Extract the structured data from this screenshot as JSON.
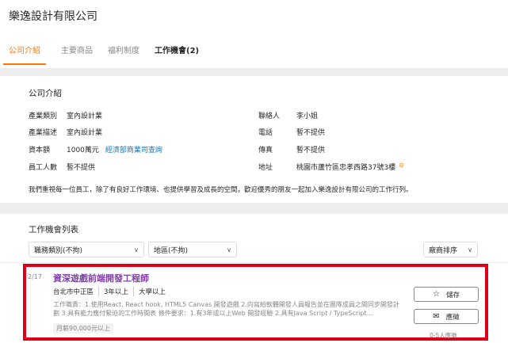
{
  "company": {
    "name": "樂逸設計有限公司"
  },
  "tabs": [
    {
      "label": "公司介紹"
    },
    {
      "label": "主要商品"
    },
    {
      "label": "福利制度"
    },
    {
      "label": "工作機會(2)"
    }
  ],
  "intro": {
    "title": "公司介紹",
    "industry_label": "產業類別",
    "industry": "室內設計業",
    "desc_label": "產業描述",
    "desc": "室內設計業",
    "capital_label": "資本額",
    "capital": "1000萬元",
    "capital_link": "經濟部商業司查詢",
    "staff_label": "員工人數",
    "staff": "暫不提供",
    "contact_label": "聯絡人",
    "contact": "李小姐",
    "phone_label": "電話",
    "phone": "暫不提供",
    "fax_label": "傳真",
    "fax": "暫不提供",
    "address_label": "地址",
    "address": "桃園市蘆竹區忠孝西路37號3樓",
    "statement": "我們重視每一位員工，除了有良好工作環境、也提供學習及成長的空間，歡迎優秀的朋友一起加入樂逸設計有限公司的工作行列。"
  },
  "jobs": {
    "title": "工作機會列表",
    "filters": {
      "category": "職務類別(不拘)",
      "area": "地區(不拘)",
      "sort": "廠商排序"
    },
    "items": [
      {
        "index": "2/17",
        "title": "資深遊戲前端開發工程師",
        "location": "台北市中正區",
        "experience": "3年以上",
        "education": "大學以上",
        "description": "工作職責：1.使用React, React hook, HTML5 Canvas 開發遊戲 2.向寫給軟體開發人員報告並在團隊成員之間同步開發計劃 3.具有能力應付緊迫的工作時間表 條件要求：1.有3年或以上Web 開發經驗 2.具有Java Script / TypeScript...",
        "salary": "月薪90,000元以上",
        "save_label": "儲存",
        "apply_label": "應徵",
        "applicants": "0-5人應徵"
      }
    ]
  },
  "icons": {
    "save": "star-icon",
    "apply": "mail-icon",
    "address": "map-pin-icon",
    "dropdown": "chevron-down-icon"
  },
  "colors": {
    "accent": "#ff7800",
    "link": "#0e76bd",
    "job_title": "#7f3ea8",
    "highlight_box": "#e00016"
  }
}
